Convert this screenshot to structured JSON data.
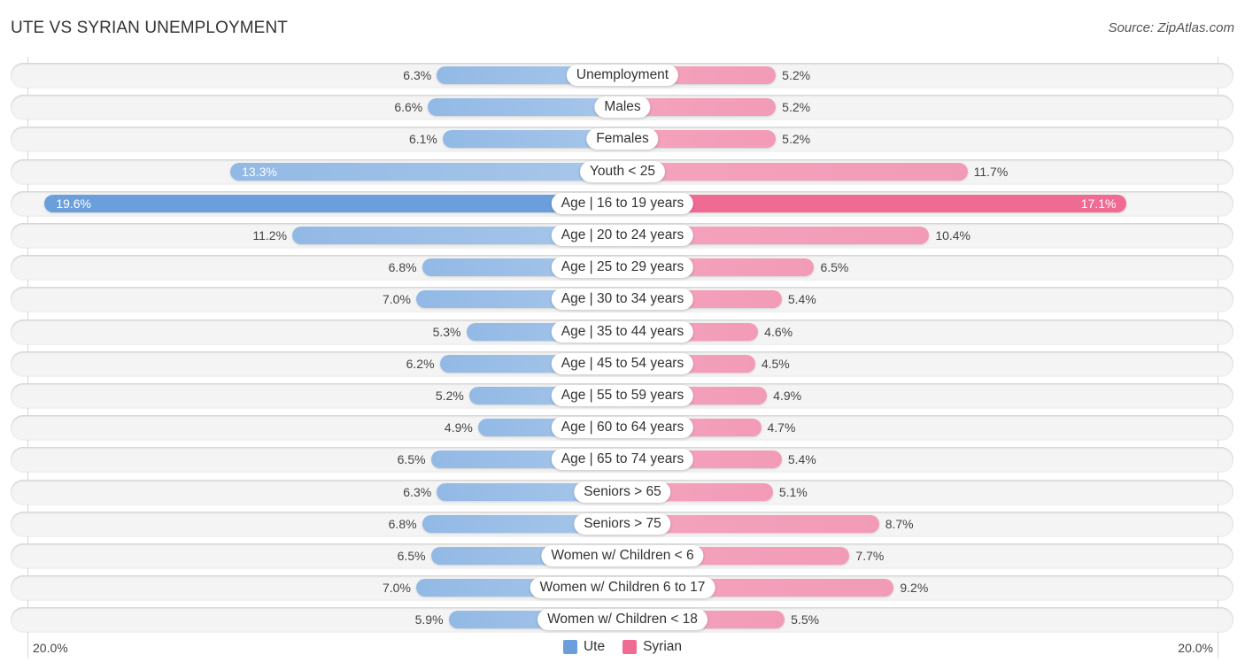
{
  "header": {
    "title": "UTE VS SYRIAN UNEMPLOYMENT",
    "source": "Source: ZipAtlas.com"
  },
  "colors": {
    "ute": "#6a9fdc",
    "ute_light": "#a4c3e9",
    "syrian": "#f06b94",
    "syrian_light": "#f4a2bc"
  },
  "legend": {
    "items": [
      {
        "label": "Ute",
        "color": "#6a9fdc"
      },
      {
        "label": "Syrian",
        "color": "#f06b94"
      }
    ]
  },
  "axis": {
    "left_label": "20.0%",
    "right_label": "20.0%"
  },
  "chart_data": {
    "type": "bar",
    "orientation": "horizontal-diverging",
    "title": "UTE VS SYRIAN UNEMPLOYMENT",
    "xlabel": "",
    "ylabel": "",
    "xlim": [
      -20,
      20
    ],
    "unit": "%",
    "legend_position": "bottom-center",
    "grid": false,
    "categories": [
      "Unemployment",
      "Males",
      "Females",
      "Youth < 25",
      "Age | 16 to 19 years",
      "Age | 20 to 24 years",
      "Age | 25 to 29 years",
      "Age | 30 to 34 years",
      "Age | 35 to 44 years",
      "Age | 45 to 54 years",
      "Age | 55 to 59 years",
      "Age | 60 to 64 years",
      "Age | 65 to 74 years",
      "Seniors > 65",
      "Seniors > 75",
      "Women w/ Children < 6",
      "Women w/ Children 6 to 17",
      "Women w/ Children < 18"
    ],
    "series": [
      {
        "name": "Ute",
        "side": "left",
        "values": [
          6.3,
          6.6,
          6.1,
          13.3,
          19.6,
          11.2,
          6.8,
          7.0,
          5.3,
          6.2,
          5.2,
          4.9,
          6.5,
          6.3,
          6.8,
          6.5,
          7.0,
          5.9
        ],
        "labels": [
          "6.3%",
          "6.6%",
          "6.1%",
          "13.3%",
          "19.6%",
          "11.2%",
          "6.8%",
          "7.0%",
          "5.3%",
          "6.2%",
          "5.2%",
          "4.9%",
          "6.5%",
          "6.3%",
          "6.8%",
          "6.5%",
          "7.0%",
          "5.9%"
        ]
      },
      {
        "name": "Syrian",
        "side": "right",
        "values": [
          5.2,
          5.2,
          5.2,
          11.7,
          17.1,
          10.4,
          6.5,
          5.4,
          4.6,
          4.5,
          4.9,
          4.7,
          5.4,
          5.1,
          8.7,
          7.7,
          9.2,
          5.5
        ],
        "labels": [
          "5.2%",
          "5.2%",
          "5.2%",
          "11.7%",
          "17.1%",
          "10.4%",
          "6.5%",
          "5.4%",
          "4.6%",
          "4.5%",
          "4.9%",
          "4.7%",
          "5.4%",
          "5.1%",
          "8.7%",
          "7.7%",
          "9.2%",
          "5.5%"
        ]
      }
    ],
    "axis_tick_labels": [
      "20.0%",
      "20.0%"
    ]
  }
}
